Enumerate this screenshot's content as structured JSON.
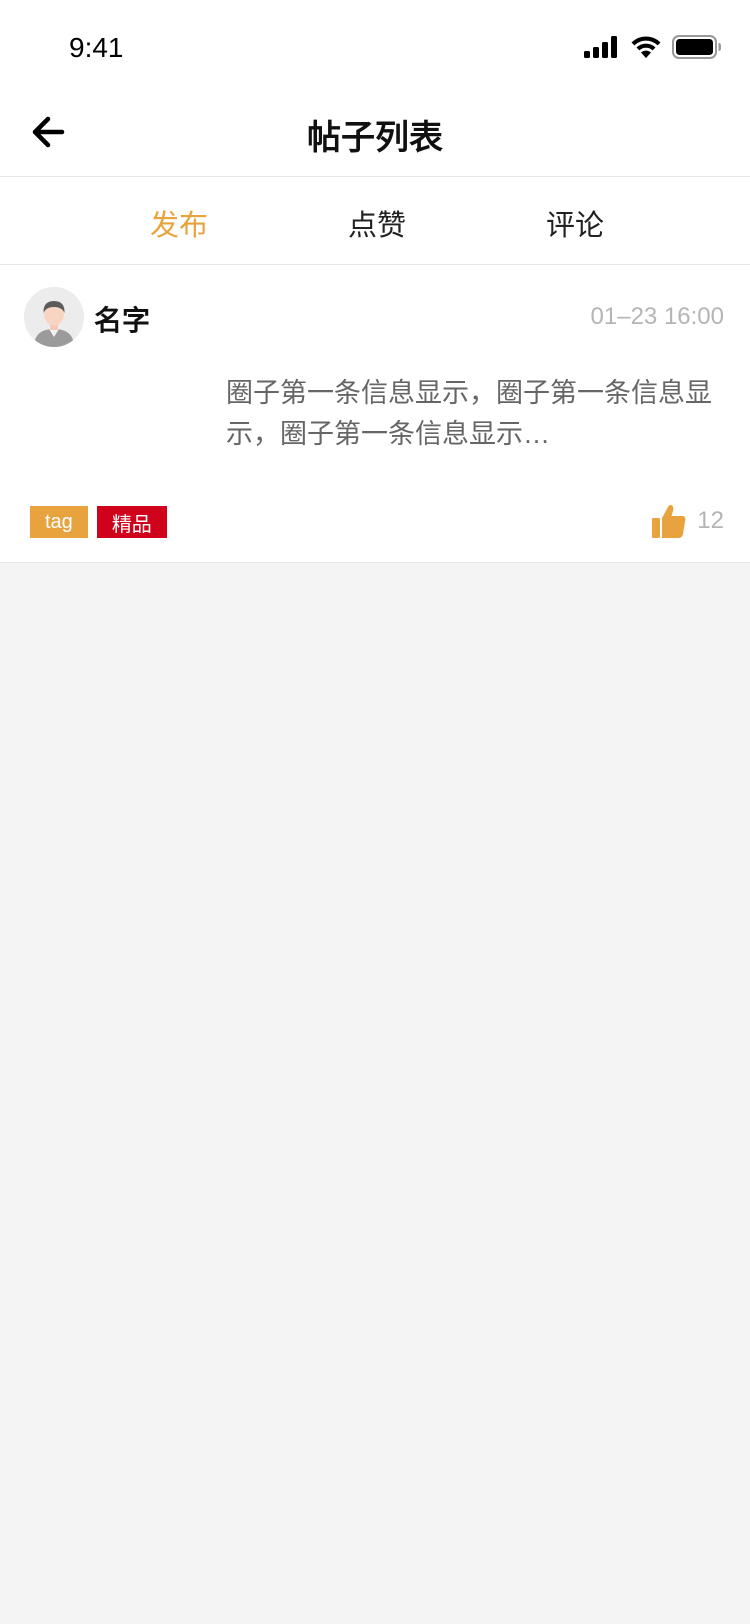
{
  "status_bar": {
    "time": "9:41",
    "icons": [
      "signal-icon",
      "wifi-icon",
      "battery-icon"
    ]
  },
  "nav": {
    "back_icon": "arrow-left-icon",
    "title": "帖子列表"
  },
  "tabs": [
    {
      "label": "发布",
      "active": true
    },
    {
      "label": "点赞",
      "active": false
    },
    {
      "label": "评论",
      "active": false
    }
  ],
  "post": {
    "author": "名字",
    "time": "01–23 16:00",
    "text": "圈子第一条信息显示，圈子第一条信息显示，圈子第一条信息显示…",
    "tags": [
      {
        "label": "tag",
        "color": "#e9a33e"
      },
      {
        "label": "精品",
        "color": "#d0021b"
      }
    ],
    "like_icon": "thumbs-up-icon",
    "like_count": "12"
  },
  "colors": {
    "accent": "#e9a33e",
    "featured": "#d0021b",
    "muted_text": "#b5b5b5",
    "background": "#f4f4f4"
  }
}
